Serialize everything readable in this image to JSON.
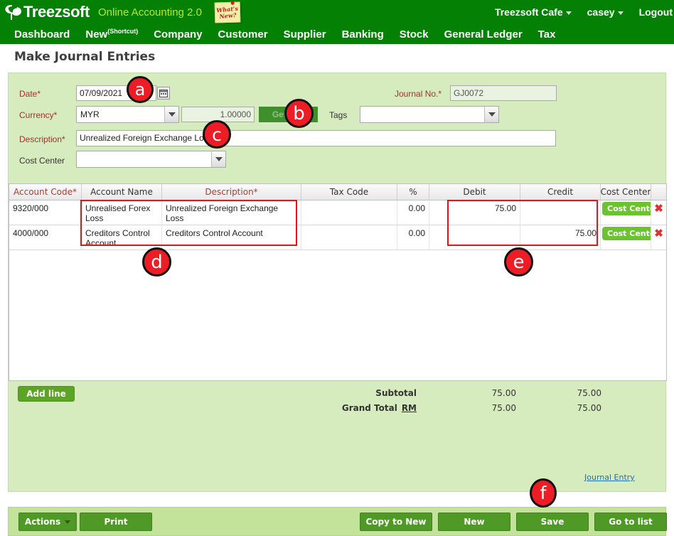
{
  "brand": {
    "name": "Treezsoft",
    "tagline": "Online Accounting 2.0",
    "whats_new": "What's New?",
    "logo_icon": "tree-logo-icon",
    "company": "Treezsoft Cafe",
    "user": "casey",
    "logout": "Logout"
  },
  "nav": {
    "items": [
      {
        "label": "Dashboard",
        "sup": ""
      },
      {
        "label": "New",
        "sup": "(Shortcut)"
      },
      {
        "label": "Company",
        "sup": ""
      },
      {
        "label": "Customer",
        "sup": ""
      },
      {
        "label": "Supplier",
        "sup": ""
      },
      {
        "label": "Banking",
        "sup": ""
      },
      {
        "label": "Stock",
        "sup": ""
      },
      {
        "label": "General Ledger",
        "sup": ""
      },
      {
        "label": "Tax",
        "sup": ""
      }
    ]
  },
  "page": {
    "title": "Make Journal Entries"
  },
  "form": {
    "date_label": "Date*",
    "date_value": "07/09/2021",
    "calendar_icon": "calendar-icon",
    "currency_label": "Currency*",
    "currency_value": "MYR",
    "rate_value": "1.00000",
    "get_rate_label": "Get rate",
    "description_label": "Description*",
    "description_value": "Unrealized Foreign Exchange Loss",
    "cost_center_label": "Cost Center",
    "cost_center_value": "",
    "journal_no_label": "Journal No.*",
    "journal_no_value": "GJ0072",
    "tags_label": "Tags",
    "tags_value": ""
  },
  "table": {
    "columns": [
      {
        "label": "Account Code*",
        "required": true
      },
      {
        "label": "Account Name",
        "required": false
      },
      {
        "label": "Description*",
        "required": true
      },
      {
        "label": "Tax Code",
        "required": false
      },
      {
        "label": "%",
        "required": false
      },
      {
        "label": "Debit",
        "required": false
      },
      {
        "label": "Credit",
        "required": false
      },
      {
        "label": "Cost Center",
        "required": false
      }
    ],
    "rows": [
      {
        "account_code": "9320/000",
        "account_name": "Unrealised Forex Loss",
        "description": "Unrealized Foreign Exchange Loss",
        "tax_code": "",
        "percent": "0.00",
        "debit": "75.00",
        "credit": "",
        "cost_center_label": "Cost Center",
        "delete_icon": "delete-x-icon"
      },
      {
        "account_code": "4000/000",
        "account_name": "Creditors Control Account",
        "description": "Creditors Control Account",
        "tax_code": "",
        "percent": "0.00",
        "debit": "",
        "credit": "75.00",
        "cost_center_label": "Cost Center",
        "delete_icon": "delete-x-icon"
      }
    ]
  },
  "totals": {
    "add_line_label": "Add line",
    "subtotal_label": "Subtotal",
    "subtotal_debit": "75.00",
    "subtotal_credit": "75.00",
    "grand_total_label": "Grand Total",
    "currency_code": "RM",
    "grand_total_debit": "75.00",
    "grand_total_credit": "75.00"
  },
  "links": {
    "journal_entry": "Journal Entry"
  },
  "actionbar": {
    "actions_label": "Actions",
    "print_label": "Print",
    "copy_to_new_label": "Copy to New",
    "new_label": "New",
    "save_label": "Save",
    "go_to_list_label": "Go to list"
  },
  "annotations": [
    {
      "id": "a",
      "label": "a"
    },
    {
      "id": "b",
      "label": "b"
    },
    {
      "id": "c",
      "label": "c"
    },
    {
      "id": "d",
      "label": "d"
    },
    {
      "id": "e",
      "label": "e"
    },
    {
      "id": "f",
      "label": "f"
    }
  ],
  "colors": {
    "brand_green": "#048104",
    "panel_green": "#d7ecbe",
    "accent_lime": "#b4ea2a",
    "required_red": "#a03232",
    "highlight_red": "#ee1111",
    "button_green": "#4f9a26",
    "cost_center_green": "#6bc42f",
    "link_blue": "#1f6fb4"
  }
}
